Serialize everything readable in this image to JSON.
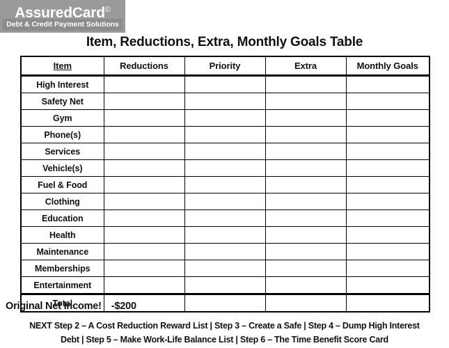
{
  "logo": {
    "brand": "AssuredCard",
    "brand_sup": "©",
    "tagline": "Debt & Credit Payment Solutions",
    "bg_color": "#9a9a9a",
    "band_color": "#8c8c8c",
    "text_color": "#ffffff"
  },
  "title": "Item, Reductions, Extra, Monthly Goals Table",
  "table": {
    "columns": [
      "Item",
      "Reductions",
      "Priority",
      "Extra",
      "Monthly Goals"
    ],
    "rows": [
      {
        "item": "High Interest",
        "reductions": "",
        "priority": "",
        "extra": "",
        "monthly_goals": ""
      },
      {
        "item": "Safety Net",
        "reductions": "",
        "priority": "",
        "extra": "",
        "monthly_goals": ""
      },
      {
        "item": "Gym",
        "reductions": "",
        "priority": "",
        "extra": "",
        "monthly_goals": ""
      },
      {
        "item": "Phone(s)",
        "reductions": "",
        "priority": "",
        "extra": "",
        "monthly_goals": ""
      },
      {
        "item": "Services",
        "reductions": "",
        "priority": "",
        "extra": "",
        "monthly_goals": ""
      },
      {
        "item": "Vehicle(s)",
        "reductions": "",
        "priority": "",
        "extra": "",
        "monthly_goals": ""
      },
      {
        "item": "Fuel & Food",
        "reductions": "",
        "priority": "",
        "extra": "",
        "monthly_goals": ""
      },
      {
        "item": "Clothing",
        "reductions": "",
        "priority": "",
        "extra": "",
        "monthly_goals": ""
      },
      {
        "item": "Education",
        "reductions": "",
        "priority": "",
        "extra": "",
        "monthly_goals": ""
      },
      {
        "item": "Health",
        "reductions": "",
        "priority": "",
        "extra": "",
        "monthly_goals": ""
      },
      {
        "item": "Maintenance",
        "reductions": "",
        "priority": "",
        "extra": "",
        "monthly_goals": ""
      },
      {
        "item": "Memberships",
        "reductions": "",
        "priority": "",
        "extra": "",
        "monthly_goals": ""
      },
      {
        "item": "Entertainment",
        "reductions": "",
        "priority": "",
        "extra": "",
        "monthly_goals": ""
      }
    ],
    "total_row": {
      "item": "Total",
      "reductions": "",
      "priority": "",
      "extra": "",
      "monthly_goals": ""
    }
  },
  "net_income": {
    "label": "Original Net Income!",
    "value": "-$200"
  },
  "next_steps": {
    "line1": "NEXT Step 2 – A Cost Reduction Reward List | Step 3 – Create a Safe | Step 4 – Dump High Interest",
    "line2": "Debt | Step 5 – Make Work-Life Balance List | Step 6 – The Time Benefit Score Card"
  }
}
